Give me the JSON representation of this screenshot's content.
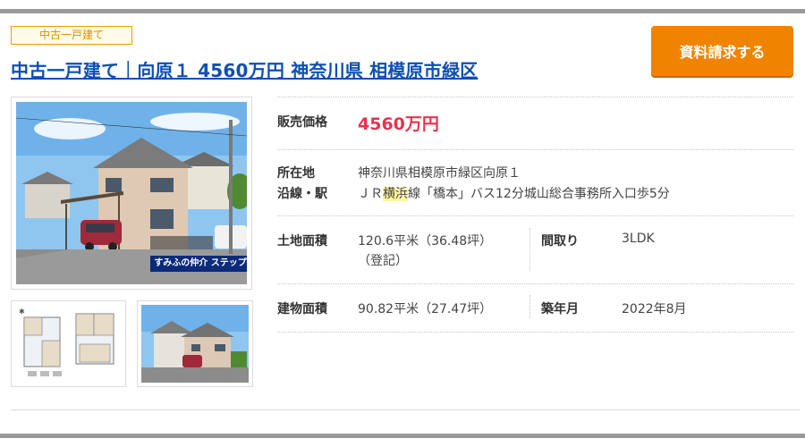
{
  "listing": {
    "tag": "中古一戸建て",
    "title": "中古一戸建て｜向原１ 4560万円 神奈川県 相模原市緑区",
    "request_button": "資料請求する",
    "photo_logo": "すみふの仲介 ステップ"
  },
  "details": {
    "price_label": "販売価格",
    "price_value": "4560万円",
    "location_label": "所在地",
    "location_value": "神奈川県相模原市緑区向原１",
    "line_label": "沿線・駅",
    "line_value_pre": "ＪＲ",
    "line_value_hl": "横浜",
    "line_value_post": "線「橋本」バス12分城山総合事務所入口歩5分",
    "land_label": "土地面積",
    "land_value": "120.6平米（36.48坪）",
    "land_note": "（登記）",
    "layout_label": "間取り",
    "layout_value": "3LDK",
    "building_label": "建物面積",
    "building_value": "90.82平米（27.47坪）",
    "built_label": "築年月",
    "built_value": "2022年8月"
  },
  "colors": {
    "accent": "#f08400",
    "title_link": "#0d4fb3",
    "price": "#e8324f",
    "tag_border": "#e8a100"
  }
}
